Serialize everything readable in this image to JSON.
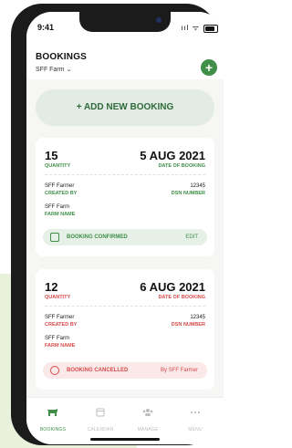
{
  "status_bar": {
    "time": "9:41",
    "icons": "ııl ᯤ"
  },
  "header": {
    "title": "BOOKINGS",
    "farm_selector": "SFF Farm ⌄",
    "add_icon": "+"
  },
  "add_booking": {
    "label": "+ ADD NEW BOOKING"
  },
  "bookings": [
    {
      "quantity": "15",
      "quantity_label": "QUANTITY",
      "date": "5 AUG 2021",
      "date_label": "DATE OF BOOKING",
      "created_by": "SFF Farmer",
      "created_by_label": "CREATED BY",
      "dsn": "12345",
      "dsn_label": "DSN NUMBER",
      "farm_name": "SFF Farm",
      "farm_name_label": "FARM NAME",
      "status": "BOOKING CONFIRMED",
      "action": "EDIT",
      "accent": "#3f8f48"
    },
    {
      "quantity": "12",
      "quantity_label": "QUANTITY",
      "date": "6 AUG 2021",
      "date_label": "DATE OF BOOKING",
      "created_by": "SFF Farmer",
      "created_by_label": "CREATED BY",
      "dsn": "12345",
      "dsn_label": "DSN NUMBER",
      "farm_name": "SFF Farm",
      "farm_name_label": "FARM NAME",
      "status": "BOOKING CANCELLED",
      "action": "By SFF Farmer",
      "accent": "#d84a4a"
    }
  ],
  "tabbar": {
    "tabs": [
      {
        "label": "BOOKINGS",
        "icon": "cow-icon",
        "active": true
      },
      {
        "label": "CALENDAR",
        "icon": "calendar-icon",
        "active": false
      },
      {
        "label": "MANAGE",
        "icon": "users-icon",
        "active": false
      },
      {
        "label": "MENU",
        "icon": "more-icon",
        "active": false
      }
    ]
  },
  "colors": {
    "brand_green": "#3f8f48",
    "cancel_red": "#d84a4a",
    "confirm_bg": "#e6f0e7",
    "cancel_bg": "#fbe8e8"
  }
}
